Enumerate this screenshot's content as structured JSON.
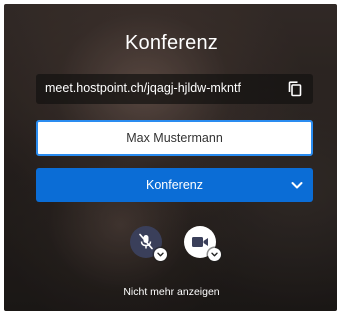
{
  "dialog": {
    "title": "Konferenz",
    "meeting_url": "meet.hostpoint.ch/jqagj-hjldw-mkntf",
    "name_input": {
      "value": "Max Mustermann",
      "placeholder": ""
    },
    "join_button_label": "Konferenz",
    "dont_show_again_label": "Nicht mehr anzeigen"
  },
  "media_controls": {
    "microphone": {
      "icon": "microphone-muted-icon",
      "state": "muted"
    },
    "camera": {
      "icon": "video-camera-icon",
      "state": "on"
    }
  },
  "icons": {
    "copy": "copy-icon",
    "join_options": "chevron-down-icon",
    "options_chevron": "chevron-down-icon"
  },
  "colors": {
    "accent": "#0b6dd6",
    "input_border": "#2a8cf0",
    "mic_button": "#3a3f5a",
    "text_on_dark": "#ffffff"
  }
}
